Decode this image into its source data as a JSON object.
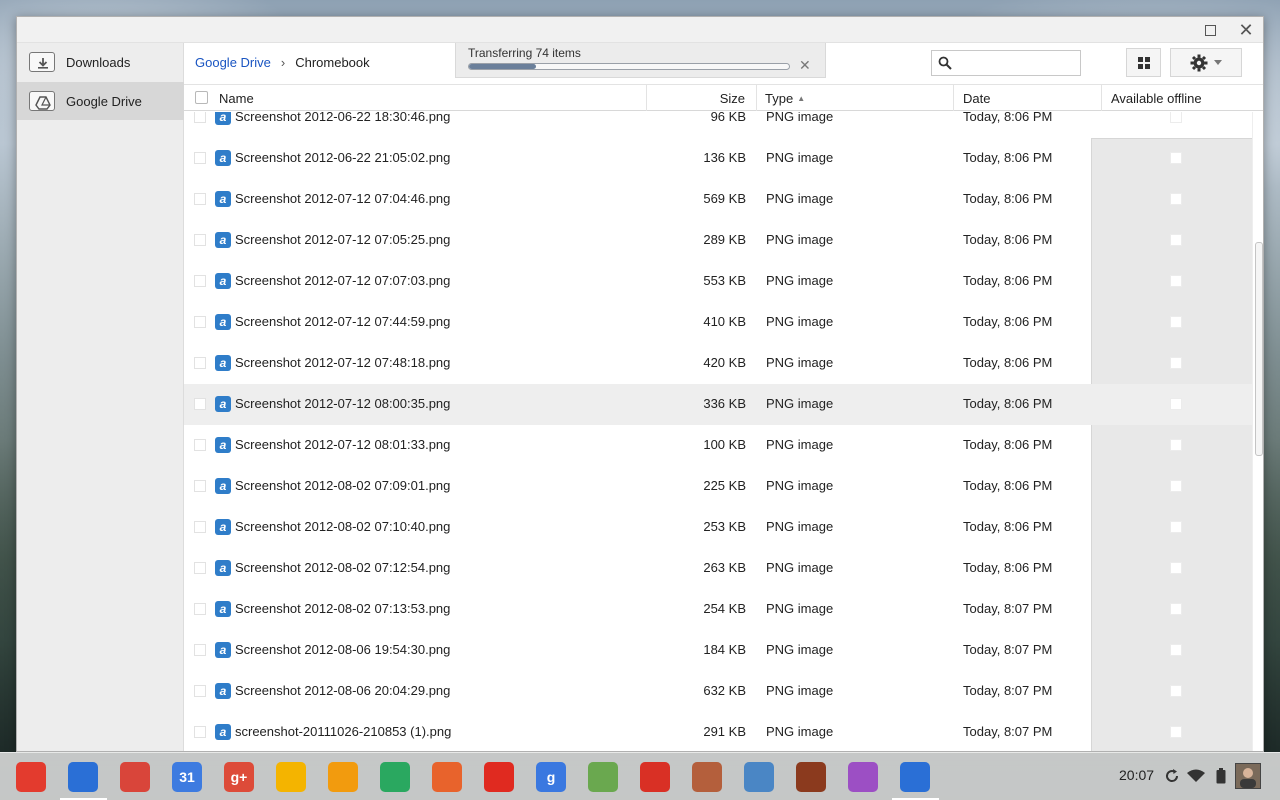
{
  "window": {
    "close_glyph": "✕"
  },
  "sidebar": {
    "items": [
      {
        "label": "Downloads",
        "icon": "downloads-folder-icon"
      },
      {
        "label": "Google Drive",
        "icon": "drive-folder-icon",
        "active": true
      }
    ]
  },
  "toolbar": {
    "breadcrumb": {
      "root": "Google Drive",
      "separator": "›",
      "current": "Chromebook"
    },
    "transfer": {
      "label": "Transferring 74 items",
      "progress": 0.21,
      "close_glyph": "✕"
    },
    "search": {
      "placeholder": ""
    }
  },
  "table": {
    "columns": {
      "name": "Name",
      "size": "Size",
      "type": "Type",
      "date": "Date",
      "offline": "Available offline"
    },
    "sort": {
      "column": "type",
      "direction": "asc"
    },
    "rows": [
      {
        "name": "Screenshot 2012-06-22 18:30:46.png",
        "size": "96 KB",
        "type": "PNG image",
        "date": "Today, 8:06 PM"
      },
      {
        "name": "Screenshot 2012-06-22 21:05:02.png",
        "size": "136 KB",
        "type": "PNG image",
        "date": "Today, 8:06 PM"
      },
      {
        "name": "Screenshot 2012-07-12 07:04:46.png",
        "size": "569 KB",
        "type": "PNG image",
        "date": "Today, 8:06 PM"
      },
      {
        "name": "Screenshot 2012-07-12 07:05:25.png",
        "size": "289 KB",
        "type": "PNG image",
        "date": "Today, 8:06 PM"
      },
      {
        "name": "Screenshot 2012-07-12 07:07:03.png",
        "size": "553 KB",
        "type": "PNG image",
        "date": "Today, 8:06 PM"
      },
      {
        "name": "Screenshot 2012-07-12 07:44:59.png",
        "size": "410 KB",
        "type": "PNG image",
        "date": "Today, 8:06 PM"
      },
      {
        "name": "Screenshot 2012-07-12 07:48:18.png",
        "size": "420 KB",
        "type": "PNG image",
        "date": "Today, 8:06 PM"
      },
      {
        "name": "Screenshot 2012-07-12 08:00:35.png",
        "size": "336 KB",
        "type": "PNG image",
        "date": "Today, 8:06 PM",
        "highlighted": true
      },
      {
        "name": "Screenshot 2012-07-12 08:01:33.png",
        "size": "100 KB",
        "type": "PNG image",
        "date": "Today, 8:06 PM"
      },
      {
        "name": "Screenshot 2012-08-02 07:09:01.png",
        "size": "225 KB",
        "type": "PNG image",
        "date": "Today, 8:06 PM"
      },
      {
        "name": "Screenshot 2012-08-02 07:10:40.png",
        "size": "253 KB",
        "type": "PNG image",
        "date": "Today, 8:06 PM"
      },
      {
        "name": "Screenshot 2012-08-02 07:12:54.png",
        "size": "263 KB",
        "type": "PNG image",
        "date": "Today, 8:06 PM"
      },
      {
        "name": "Screenshot 2012-08-02 07:13:53.png",
        "size": "254 KB",
        "type": "PNG image",
        "date": "Today, 8:07 PM"
      },
      {
        "name": "Screenshot 2012-08-06 19:54:30.png",
        "size": "184 KB",
        "type": "PNG image",
        "date": "Today, 8:07 PM"
      },
      {
        "name": "Screenshot 2012-08-06 20:04:29.png",
        "size": "632 KB",
        "type": "PNG image",
        "date": "Today, 8:07 PM"
      },
      {
        "name": "screenshot-20111026-210853 (1).png",
        "size": "291 KB",
        "type": "PNG image",
        "date": "Today, 8:07 PM"
      }
    ]
  },
  "shelf": {
    "apps": [
      {
        "name": "chrome-app-icon",
        "color": "#e33b2e",
        "label": ""
      },
      {
        "name": "files-app-icon",
        "color": "#2a6fd6",
        "label": ""
      },
      {
        "name": "gmail-app-icon",
        "color": "#d9453a",
        "label": ""
      },
      {
        "name": "calendar-app-icon",
        "color": "#3d7be0",
        "label": "31"
      },
      {
        "name": "google-plus-app-icon",
        "color": "#dd4b39",
        "label": "g+"
      },
      {
        "name": "drive-app-icon",
        "color": "#f4b400",
        "label": ""
      },
      {
        "name": "music-app-icon",
        "color": "#f29b0e",
        "label": ""
      },
      {
        "name": "play-store-app-icon",
        "color": "#2aa860",
        "label": ""
      },
      {
        "name": "rss-app-icon",
        "color": "#e8632c",
        "label": ""
      },
      {
        "name": "youtube-app-icon",
        "color": "#e02a20",
        "label": ""
      },
      {
        "name": "google-search-app-icon",
        "color": "#3a78e0",
        "label": "g"
      },
      {
        "name": "tree-app-icon",
        "color": "#6aa84f",
        "label": ""
      },
      {
        "name": "maps-app-icon",
        "color": "#d93025",
        "label": ""
      },
      {
        "name": "package-app-icon",
        "color": "#b45f3c",
        "label": ""
      },
      {
        "name": "remote-desktop-app-icon",
        "color": "#4a86c5",
        "label": ""
      },
      {
        "name": "bible-app-icon",
        "color": "#8b3a1e",
        "label": ""
      },
      {
        "name": "picasa-app-icon",
        "color": "#9c4fc4",
        "label": ""
      },
      {
        "name": "files-window-app-icon",
        "color": "#2a6fd6",
        "label": ""
      }
    ],
    "clock": "20:07"
  }
}
